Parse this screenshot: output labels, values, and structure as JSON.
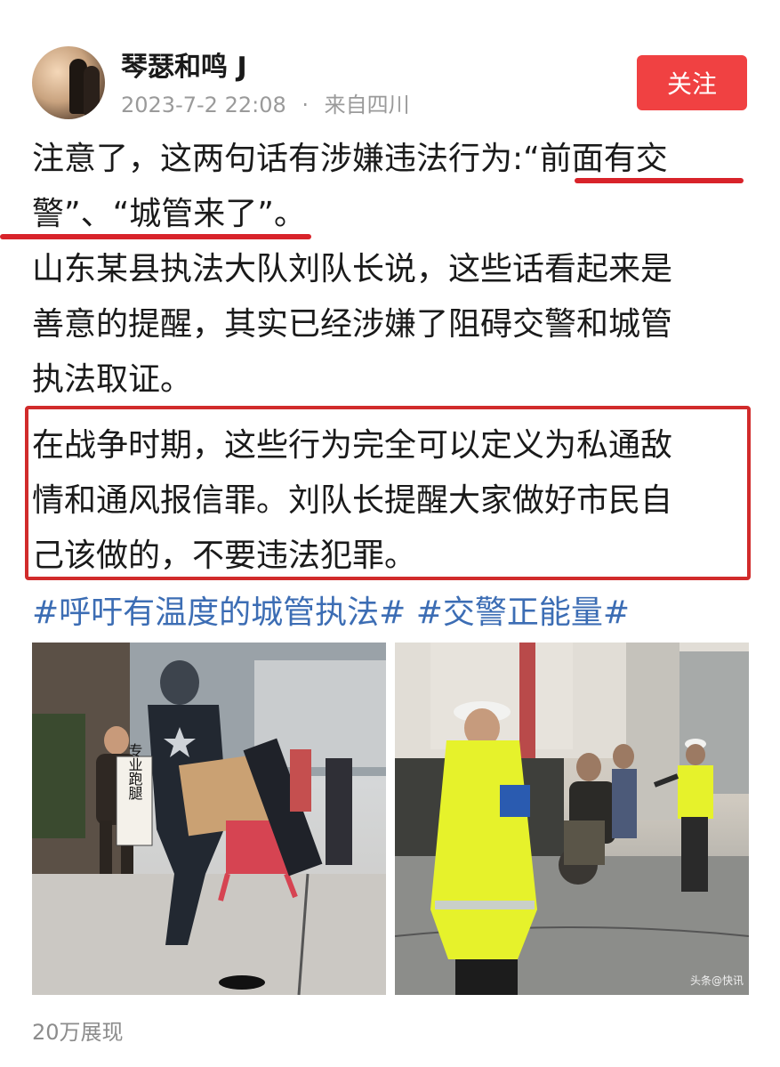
{
  "header": {
    "username": "琴瑟和鸣 J",
    "timestamp": "2023-7-2 22:08",
    "separator": "·",
    "location": "来自四川",
    "follow_label": "关注"
  },
  "post": {
    "p1_line1_a": "注意了，这两句话有涉嫌违法行为:“",
    "p1_line1_b": "前面有交",
    "p1_line2": "警”、“城管来了”。",
    "p2_line1": "山东某县执法大队刘队长说，这些话看起来是",
    "p2_line2": "善意的提醒，其实已经涉嫌了阻碍交警和城管",
    "p2_line3": "执法取证。",
    "p3_line1": "在战争时期，这些行为完全可以定义为私通敌",
    "p3_line2": "情和通风报信罪。刘队长提醒大家做好市民自",
    "p3_line3": "己该做的，不要违法犯罪。",
    "hashtags": "#呼吁有温度的城管执法# #交警正能量#"
  },
  "images": {
    "left_sign": "专业跑腿",
    "right_watermark": "头条@快讯"
  },
  "footer": {
    "views": "20万展现"
  },
  "colors": {
    "follow_bg": "#f04142",
    "underline": "#d8232a",
    "box_border": "#d12b2b",
    "hashtag": "#3c6db4"
  }
}
